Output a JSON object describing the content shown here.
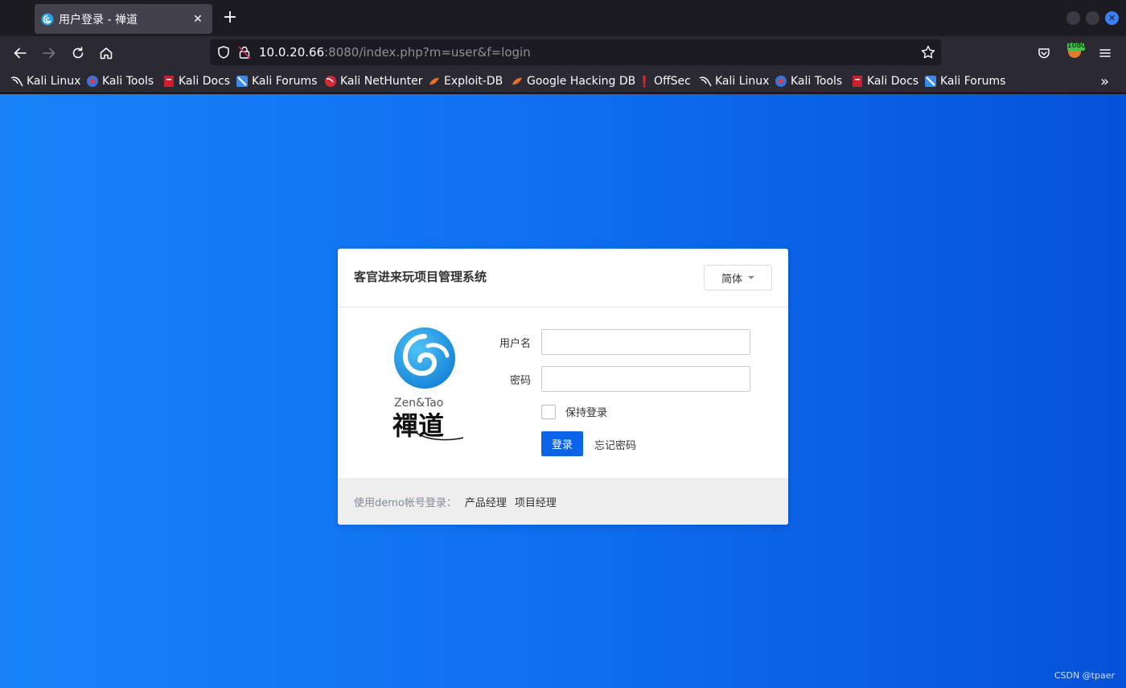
{
  "tab": {
    "title": "用户登录 - 禅道",
    "favicon": "zentao-icon"
  },
  "urlbar": {
    "host": "10.0.20.66",
    "rest": ":8080/index.php?m=user&f=login"
  },
  "extension": {
    "badge": "1080"
  },
  "bookmarks": [
    {
      "label": "Kali Linux",
      "icon": "kali-dragon-icon"
    },
    {
      "label": "Kali Tools",
      "icon": "kali-tools-icon"
    },
    {
      "label": "Kali Docs",
      "icon": "kali-docs-icon"
    },
    {
      "label": "Kali Forums",
      "icon": "kali-forums-icon"
    },
    {
      "label": "Kali NetHunter",
      "icon": "kali-nethunter-icon"
    },
    {
      "label": "Exploit-DB",
      "icon": "exploit-db-icon"
    },
    {
      "label": "Google Hacking DB",
      "icon": "ghdb-icon"
    },
    {
      "label": "OffSec",
      "icon": "offsec-icon"
    },
    {
      "label": "Kali Linux",
      "icon": "kali-dragon-icon"
    },
    {
      "label": "Kali Tools",
      "icon": "kali-tools-icon"
    },
    {
      "label": "Kali Docs",
      "icon": "kali-docs-icon"
    },
    {
      "label": "Kali Forums",
      "icon": "kali-forums-icon"
    }
  ],
  "login": {
    "title": "客官进来玩项目管理系统",
    "lang": "简体",
    "logo_text_en": "Zen&Tao",
    "logo_text_cn": "禪道",
    "username_label": "用户名",
    "password_label": "密码",
    "username_value": "",
    "password_value": "",
    "keep_login": "保持登录",
    "login_button": "登录",
    "forgot_password": "忘记密码",
    "demo_label": "使用demo帐号登录：",
    "demo_links": [
      "产品经理",
      "项目经理"
    ]
  },
  "watermark": "CSDN @tpaer",
  "colors": {
    "accent": "#0c64eb",
    "page_bg_start": "#1783f7",
    "page_bg_end": "#0552d9"
  }
}
